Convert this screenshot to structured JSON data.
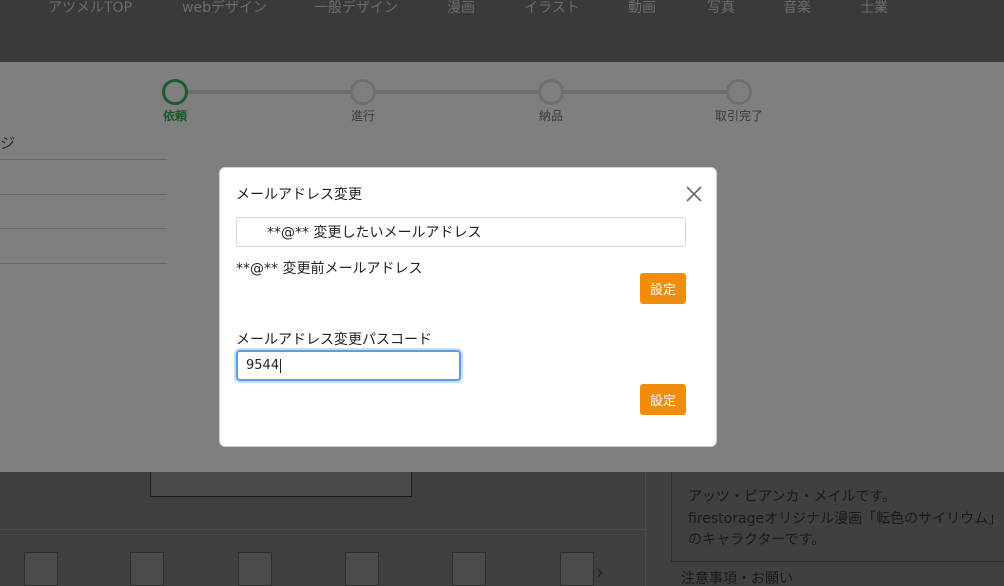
{
  "nav": {
    "items": [
      "アツメルTOP",
      "webデザイン",
      "一般デザイン",
      "漫画",
      "イラスト",
      "動画",
      "写真",
      "音楽",
      "士業"
    ]
  },
  "progress": {
    "steps": [
      {
        "label": "依頼",
        "active": true
      },
      {
        "label": "進行",
        "active": false
      },
      {
        "label": "納品",
        "active": false
      },
      {
        "label": "取引完了",
        "active": false
      }
    ]
  },
  "sidebar": {
    "heading": "ジ"
  },
  "modal": {
    "title": "メールアドレス変更",
    "new_email_value": "**@**  変更したいメールアドレス",
    "current_email": "**@**  変更前メールアドレス",
    "set_button_1": "設定",
    "passcode_label": "メールアドレス変更パスコード",
    "passcode_value": "9544",
    "set_button_2": "設定"
  },
  "info": {
    "line1": "アッツ・ビアンカ・メイルです。",
    "line2": "firestorageオリジナル漫画「転色のサイリウム」",
    "line3": "のキャラクターです。",
    "notes_heading": "注意事項・お願い"
  },
  "colors": {
    "accent_orange": "#f28c0c",
    "step_active_green": "#1d5a2b",
    "focus_blue": "#5b9be0"
  }
}
